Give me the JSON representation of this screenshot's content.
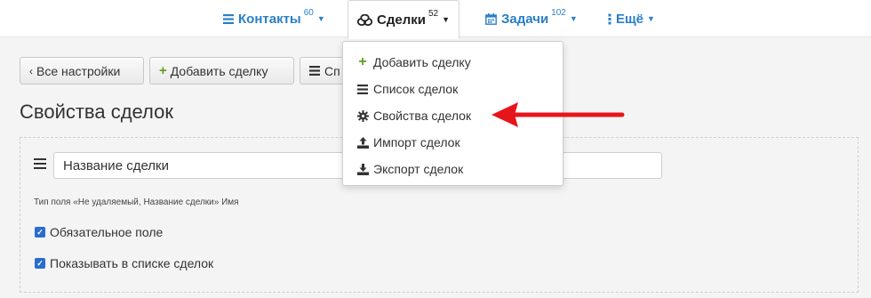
{
  "nav": {
    "contacts": {
      "label": "Контакты",
      "count": "60"
    },
    "deals": {
      "label": "Сделки",
      "count": "52"
    },
    "tasks": {
      "label": "Задачи",
      "count": "102"
    },
    "more": {
      "label": "Ещё"
    }
  },
  "toolbar": {
    "all_settings": "Все настройки",
    "add_deal": "Добавить сделку",
    "list_partial": "Сп"
  },
  "page": {
    "title": "Свойства сделок"
  },
  "field": {
    "name_value": "Название сделки",
    "type_text": "Тип поля «Не удаляемый, Название сделки» Имя",
    "required_label": "Обязательное поле",
    "show_in_list_label": "Показывать в списке сделок"
  },
  "dropdown": {
    "items": [
      {
        "label": "Добавить сделку",
        "icon": "plus-icon"
      },
      {
        "label": "Список сделок",
        "icon": "list-icon"
      },
      {
        "label": "Свойства сделок",
        "icon": "gear-icon"
      },
      {
        "label": "Импорт сделок",
        "icon": "upload-icon"
      },
      {
        "label": "Экспорт сделок",
        "icon": "download-icon"
      }
    ]
  },
  "colors": {
    "link": "#2a7fc6",
    "add": "#5a9e1e",
    "arrow": "#e8141c"
  }
}
